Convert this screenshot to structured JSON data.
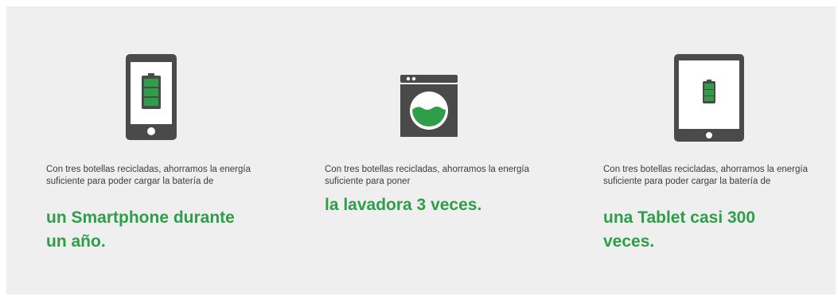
{
  "colors": {
    "background": "#efefef",
    "icon": "#4a4a4a",
    "accent": "#2e9e48",
    "text": "#3c3c3c"
  },
  "items": [
    {
      "icon": "smartphone-battery-icon",
      "text": "Con tres botellas recicladas, ahorramos la energía suficiente para poder cargar la batería de",
      "highlight": "un Smartphone durante un año."
    },
    {
      "icon": "washing-machine-icon",
      "text": "Con tres botellas recicladas, ahorramos la energía suficiente para poner",
      "highlight": "la lavadora 3 veces."
    },
    {
      "icon": "tablet-battery-icon",
      "text": "Con tres botellas recicladas, ahorramos la energía suficiente para poder cargar la batería de",
      "highlight": "una Tablet casi 300 veces."
    }
  ]
}
